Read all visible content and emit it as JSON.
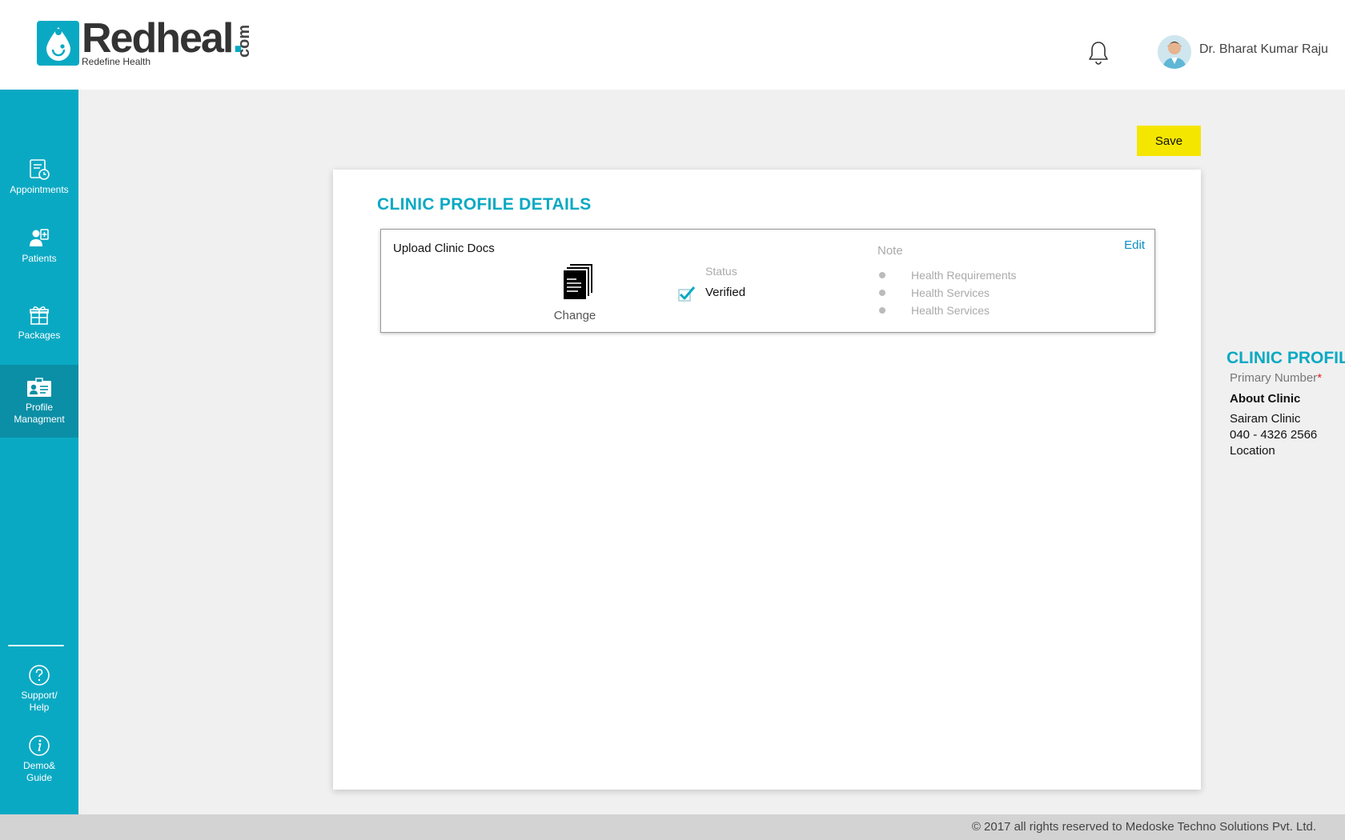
{
  "brand": {
    "name": "Redheal",
    "dot": ".",
    "com": "com",
    "tagline": "Redefine Health",
    "accent": "#0aa9c3"
  },
  "header": {
    "user_name": "Dr. Bharat Kumar Raju",
    "bell_icon": "bell-icon"
  },
  "sidebar": {
    "items": [
      {
        "label": "Appointments",
        "icon": "appointments-icon"
      },
      {
        "label": "Patients",
        "icon": "patients-icon"
      },
      {
        "label": "Packages",
        "icon": "packages-icon"
      },
      {
        "label": "Profile Managment",
        "icon": "profile-icon",
        "active": true
      },
      {
        "label": "Support/ Help",
        "icon": "help-icon"
      },
      {
        "label": "Demo& Guide",
        "icon": "info-icon"
      }
    ]
  },
  "toolbar": {
    "save_label": "Save",
    "save_color": "#f5e600"
  },
  "card": {
    "title": "CLINIC PROFILE DETAILS",
    "docs": {
      "heading": "Upload Clinic Docs",
      "edit_label": "Edit",
      "change_label": "Change",
      "status_label": "Status",
      "status_value": "Verified",
      "note_label": "Note",
      "notes": [
        "Health Requirements",
        "Health Services",
        "Health Services"
      ]
    }
  },
  "side_panel": {
    "title": "CLINIC PROFIL",
    "primary_number_label": "Primary Number",
    "required_mark": "*",
    "about_label": "About Clinic",
    "clinic_name": "Sairam Clinic",
    "phone": "040 - 4326 2566",
    "location": "Location"
  },
  "footer": {
    "text": "© 2017 all rights reserved to Medoske Techno Solutions Pvt. Ltd."
  }
}
